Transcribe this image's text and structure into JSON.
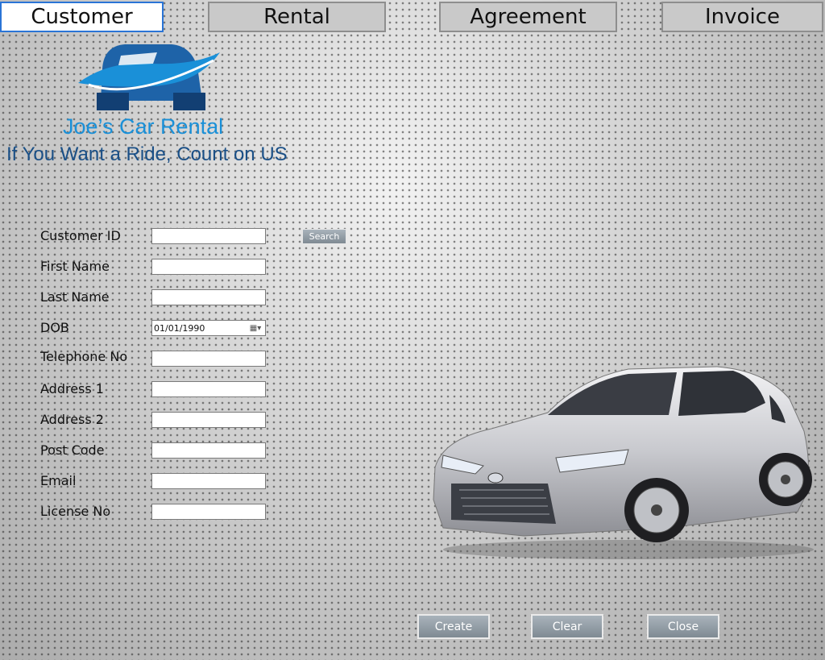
{
  "tabs": [
    {
      "label": "Customer",
      "active": true
    },
    {
      "label": "Rental",
      "active": false
    },
    {
      "label": "Agreement",
      "active": false
    },
    {
      "label": "Invoice",
      "active": false
    }
  ],
  "brand": {
    "name": "Joe’s Car Rental",
    "tagline": "If You Want a Ride, Count on US"
  },
  "form": {
    "fields": [
      {
        "label": "Customer ID",
        "value": ""
      },
      {
        "label": "First Name",
        "value": ""
      },
      {
        "label": "Last Name",
        "value": ""
      },
      {
        "label": "DOB",
        "value": "01/01/1990"
      },
      {
        "label": "Telephone No",
        "value": ""
      },
      {
        "label": "Address 1",
        "value": ""
      },
      {
        "label": "Address 2",
        "value": ""
      },
      {
        "label": "Post Code",
        "value": ""
      },
      {
        "label": "Email",
        "value": ""
      },
      {
        "label": "License No",
        "value": ""
      }
    ],
    "search_label": "Search"
  },
  "buttons": {
    "create": "Create",
    "clear": "Clear",
    "close": "Close"
  },
  "colors": {
    "brand_light": "#1a90d8",
    "brand_dark": "#1a4f86",
    "active_tab_border": "#2a74d6"
  },
  "icons": {
    "logo": "car-logo-icon",
    "date_picker": "calendar-icon",
    "car_image": "car-image"
  }
}
